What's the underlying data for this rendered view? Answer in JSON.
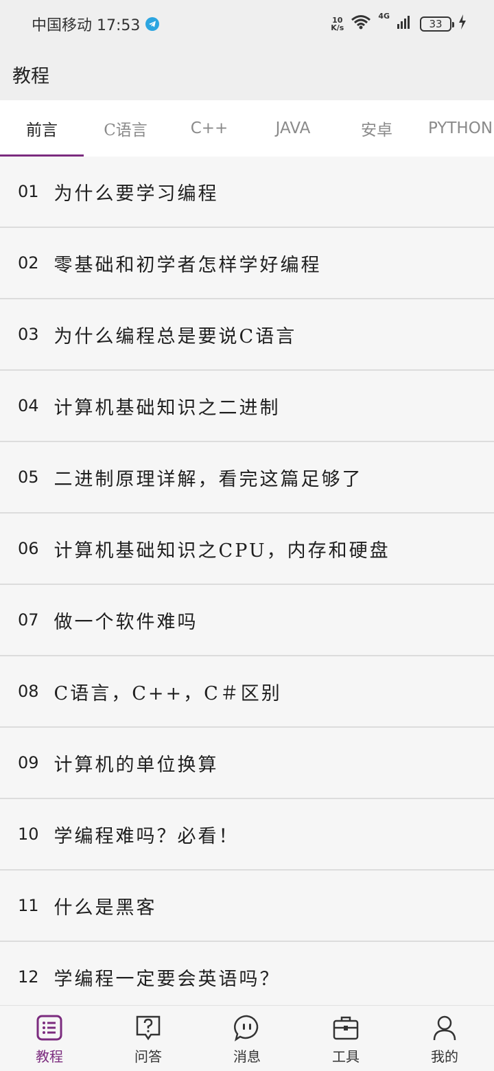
{
  "status_bar": {
    "carrier_time": "中国移动 17:53",
    "net_speed_top": "10",
    "net_speed_bottom": "K/s",
    "signal_label": "4G",
    "battery": "33"
  },
  "header": {
    "title": "教程"
  },
  "tabs": [
    {
      "label": "前言"
    },
    {
      "label": "C语言"
    },
    {
      "label": "C++"
    },
    {
      "label": "JAVA"
    },
    {
      "label": "安卓"
    },
    {
      "label": "PYTHON"
    }
  ],
  "active_tab": 0,
  "accent_color": "#7b2b7e",
  "list": [
    {
      "num": "01",
      "title": "为什么要学习编程"
    },
    {
      "num": "02",
      "title": "零基础和初学者怎样学好编程"
    },
    {
      "num": "03",
      "title": "为什么编程总是要说C语言"
    },
    {
      "num": "04",
      "title": "计算机基础知识之二进制"
    },
    {
      "num": "05",
      "title": "二进制原理详解，看完这篇足够了"
    },
    {
      "num": "06",
      "title": "计算机基础知识之CPU，内存和硬盘"
    },
    {
      "num": "07",
      "title": "做一个软件难吗"
    },
    {
      "num": "08",
      "title": "C语言，C++，C＃区别"
    },
    {
      "num": "09",
      "title": "计算机的单位换算"
    },
    {
      "num": "10",
      "title": "学编程难吗？必看！"
    },
    {
      "num": "11",
      "title": "什么是黑客"
    },
    {
      "num": "12",
      "title": "学编程一定要会英语吗？"
    }
  ],
  "bottom_nav": [
    {
      "label": "教程",
      "icon": "list-icon"
    },
    {
      "label": "问答",
      "icon": "question-icon"
    },
    {
      "label": "消息",
      "icon": "message-icon"
    },
    {
      "label": "工具",
      "icon": "toolbox-icon"
    },
    {
      "label": "我的",
      "icon": "user-icon"
    }
  ]
}
